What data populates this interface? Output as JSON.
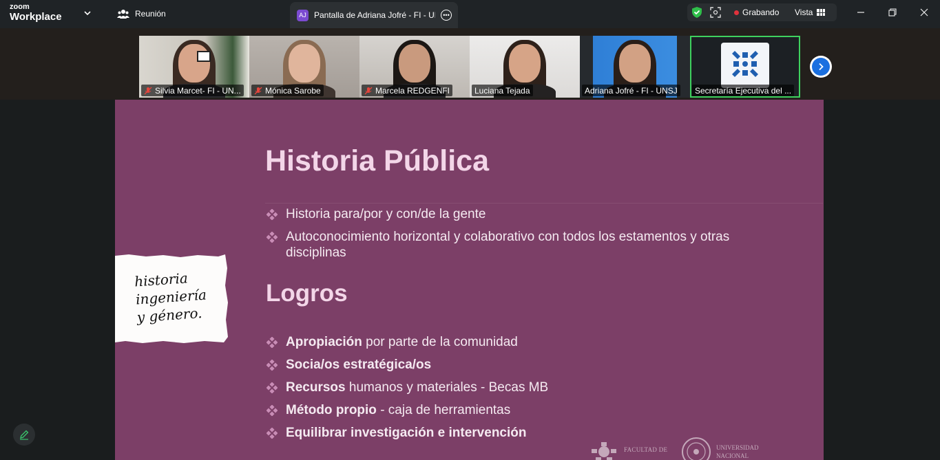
{
  "app": {
    "brand_top": "zoom",
    "brand_bottom": "Workplace"
  },
  "meeting": {
    "label": "Reunión",
    "icon": "people-icon"
  },
  "share_tab": {
    "initials": "AJ",
    "title": "Pantalla de Adriana Jofré - FI - UN",
    "more_icon": "more-icon"
  },
  "status": {
    "shield_icon": "shield-check-icon",
    "scan_icon": "scan-icon",
    "recording": "Grabando",
    "view": "Vista"
  },
  "participants": [
    {
      "name": "Silvia Marcet- FI - UN...",
      "muted": true
    },
    {
      "name": "Mónica Sarobe",
      "muted": true
    },
    {
      "name": "Marcela REDGENFI",
      "muted": true
    },
    {
      "name": "Luciana Tejada",
      "muted": false
    },
    {
      "name": "Adriana Jofré - FI - UNSJ",
      "muted": false
    },
    {
      "name": "Secretaría Ejecutiva del ...",
      "muted": false
    }
  ],
  "slide": {
    "title": "Historia Pública",
    "bullets1": [
      "Historia para/por y con/de la gente",
      "Autoconocimiento horizontal y colaborativo con todos los estamentos y otras disciplinas"
    ],
    "subtitle": "Logros",
    "bullets2": [
      {
        "bold": "Apropiación",
        "rest": " por parte de la comunidad"
      },
      {
        "bold": "Socia/os estratégica/os",
        "rest": ""
      },
      {
        "bold": "Recursos",
        "rest": " humanos y materiales - Becas MB"
      },
      {
        "bold": "Método propio",
        "rest": " - caja de herramientas"
      },
      {
        "bold": "Equilibrar investigación e intervención",
        "rest": ""
      }
    ],
    "handwritten": [
      "historia",
      "ingeniería",
      "y género."
    ],
    "logo_left": "FACULTAD DE",
    "logo_right": [
      "UNIVERSIDAD",
      "NACIONAL"
    ]
  },
  "colors": {
    "slide_bg": "#7c3f67",
    "title": "#f3d6e8",
    "bullet": "#c98db6",
    "active_border": "#3ed15e",
    "rec": "#e0323c"
  }
}
